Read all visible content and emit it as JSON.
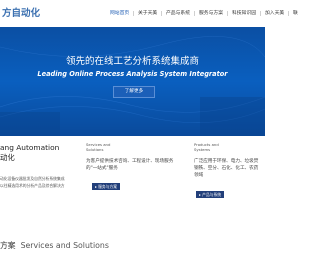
{
  "header": {
    "logo_text": "方自动化",
    "nav": [
      {
        "label": "网站首页",
        "active": true
      },
      {
        "label": "关于天美",
        "active": false
      },
      {
        "label": "产品与系统",
        "active": false
      },
      {
        "label": "服务与方案",
        "active": false
      },
      {
        "label": "科技知识园",
        "active": false
      },
      {
        "label": "加入天美",
        "active": false
      },
      {
        "label": "联",
        "active": false
      }
    ]
  },
  "hero": {
    "title": "领先的在线工艺分析系统集成商",
    "subtitle": "Leading Online Process Analysis System Integrator",
    "button_label": "了解更多",
    "colors": {
      "top": "#0b4fa3",
      "mid": "#0a5fbf",
      "bottom": "#0a4a9b"
    }
  },
  "about": {
    "title_en": "ang Automation",
    "title_cn": "动化",
    "lines": [
      "动化设备仪器批发及自然分析系统集成",
      "以往精选用术的分析产品及综合解决方"
    ]
  },
  "services": {
    "label_line1": "Services and",
    "label_line2": "Solutions",
    "text_line1": "为客户提供技术咨询、工程设计、现场服务",
    "text_line2": "的\"一站式\"服务",
    "button_label": "服务与方案"
  },
  "products": {
    "label_line1": "Products and",
    "label_line2": "Systems",
    "text_line1": "广泛应用于环保、电力、垃圾焚",
    "text_line2": "钢铁、空分、石化、化工、农药",
    "text_line3": "领域",
    "button_label": "产品与系统"
  },
  "solutions_heading": {
    "cn": "方案",
    "en": "Services and Solutions"
  }
}
